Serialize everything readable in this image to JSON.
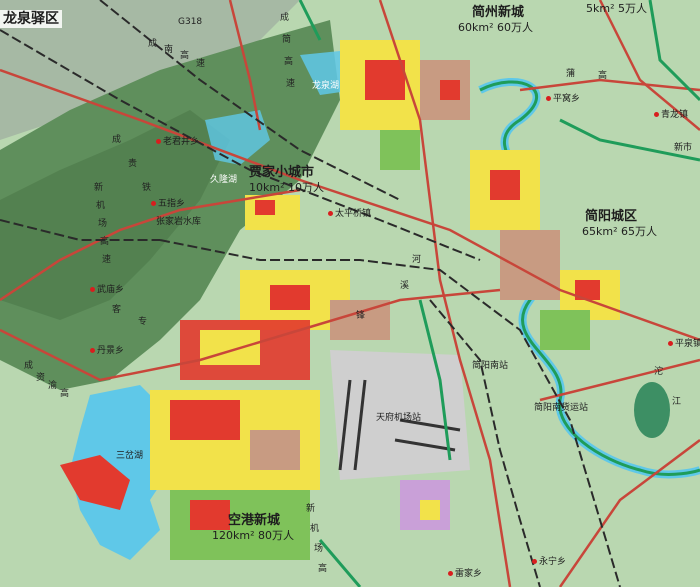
{
  "districts": {
    "longquanyi": "龙泉驿区",
    "jianyang_city": {
      "name": "简阳城区",
      "stats": "65km² 65万人"
    },
    "jianzhou": {
      "name": "简州新城",
      "stats": "60km² 60万人"
    },
    "jiajia": {
      "name": "贾家小城市",
      "stats": "10km² 10万人"
    },
    "airport_city": {
      "name": "空港新城",
      "stats": "120km² 80万人"
    },
    "corner_stats": "5km² 5万人"
  },
  "places": {
    "laojunjing": "老君井乡",
    "jiulonghu": "久隆湖",
    "wuzhi": "五指乡",
    "zhangjiayan": "张家岩水库",
    "wumiao": "武庙乡",
    "danjing": "丹景乡",
    "sancha": "三岔湖",
    "taiping": "太平桥镇",
    "longquan_lake": "龙泉湖",
    "pingwo": "平窝乡",
    "qinglong": "青龙镇",
    "xinshi": "新市",
    "pingquan": "平泉镇",
    "jianyang_south": "简阳南站",
    "jianyang_south_freight": "简阳南货运站",
    "tianfu_airport": "天府机场站",
    "yongning": "永宁乡",
    "leijia": "雷家乡"
  },
  "roads": {
    "g318": "G318",
    "chengjian_expressway": [
      "成",
      "简",
      "高",
      "速"
    ],
    "chengnan_expressway": [
      "成",
      "南",
      "高",
      "速"
    ],
    "chenggui_railway": [
      "成",
      "贵",
      "铁"
    ],
    "chengdu_airport_line": [
      "成",
      "新",
      "机",
      "场",
      "高",
      "速"
    ],
    "airport_expressway": [
      "新",
      "机",
      "场",
      "高",
      "速"
    ],
    "yuanjiang": [
      "沱",
      "江"
    ],
    "jianyang_river": [
      "绛",
      "溪",
      "河"
    ],
    "zhixi": [
      "锋",
      "溪"
    ],
    "ring_expressway": [
      "简",
      "蒲",
      "高",
      "速"
    ],
    "chengzi": [
      "成",
      "资",
      "渝",
      "高",
      "速"
    ],
    "chengzhi_rail": [
      "成",
      "资",
      "客",
      "专"
    ]
  },
  "colors": {
    "mountain": "#5f8f5c",
    "plain": "#b9d7b0",
    "green_land": "#7fc25a",
    "residential": "#f2e24a",
    "commercial": "#e23a2e",
    "industrial": "#c89b82",
    "lake": "#5fc8e8",
    "highway": "#c8463a",
    "railway": "#2a2a2a"
  }
}
